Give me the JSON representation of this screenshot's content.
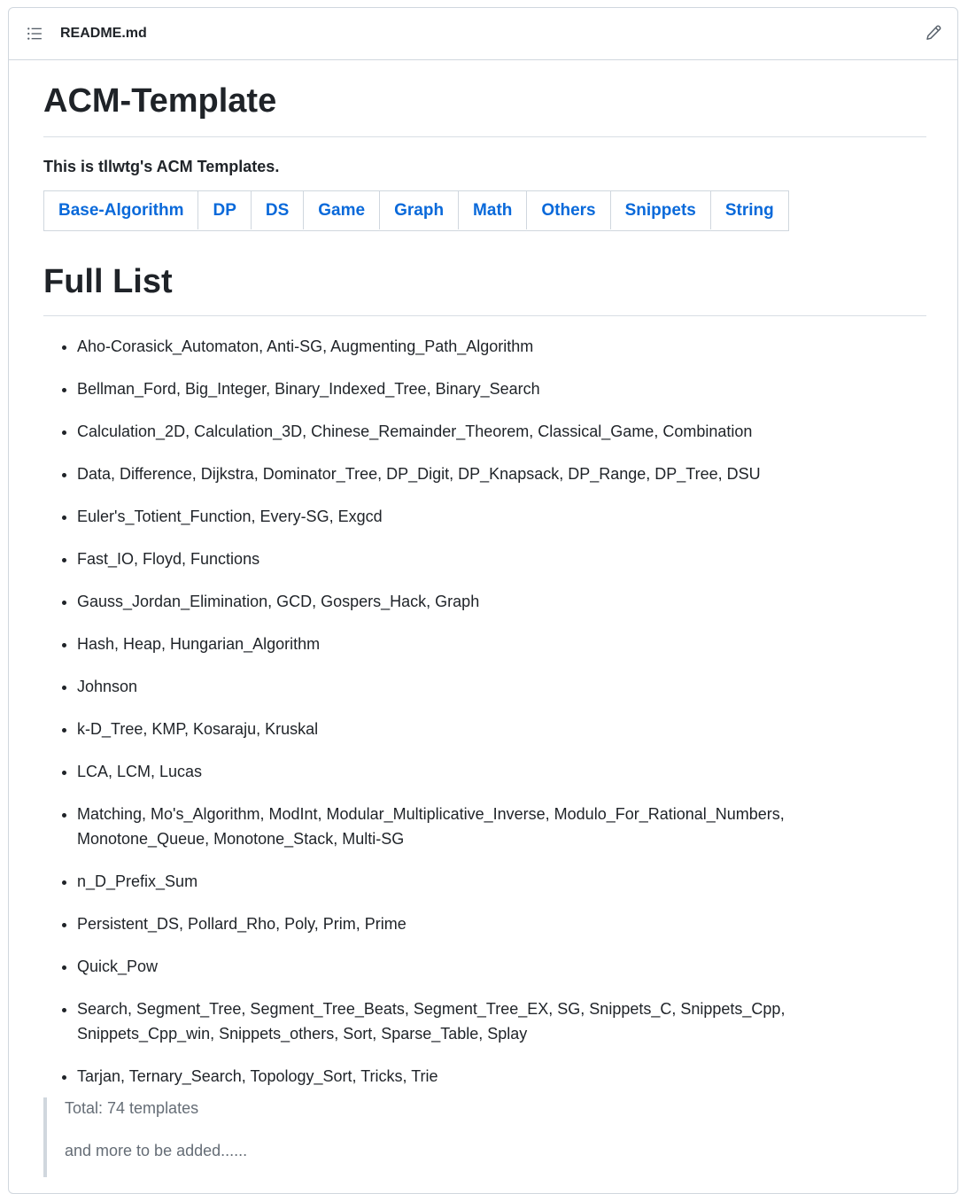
{
  "header": {
    "file_name": "README.md",
    "toc_icon": "list-unordered-icon",
    "edit_icon": "pencil-icon"
  },
  "readme": {
    "title": "ACM-Template",
    "intro": "This is tllwtg's ACM Templates.",
    "nav": [
      "Base-Algorithm",
      "DP",
      "DS",
      "Game",
      "Graph",
      "Math",
      "Others",
      "Snippets",
      "String"
    ],
    "full_list_heading": "Full List",
    "items": [
      "Aho-Corasick_Automaton, Anti-SG, Augmenting_Path_Algorithm",
      "Bellman_Ford, Big_Integer, Binary_Indexed_Tree, Binary_Search",
      "Calculation_2D, Calculation_3D, Chinese_Remainder_Theorem, Classical_Game, Combination",
      "Data, Difference, Dijkstra, Dominator_Tree, DP_Digit, DP_Knapsack, DP_Range, DP_Tree, DSU",
      "Euler's_Totient_Function, Every-SG, Exgcd",
      "Fast_IO, Floyd, Functions",
      "Gauss_Jordan_Elimination, GCD, Gospers_Hack, Graph",
      "Hash, Heap, Hungarian_Algorithm",
      "Johnson",
      "k-D_Tree, KMP, Kosaraju, Kruskal",
      "LCA, LCM, Lucas",
      "Matching, Mo's_Algorithm, ModInt, Modular_Multiplicative_Inverse, Modulo_For_Rational_Numbers, Monotone_Queue, Monotone_Stack, Multi-SG",
      "n_D_Prefix_Sum",
      "Persistent_DS, Pollard_Rho, Poly, Prim, Prime",
      "Quick_Pow",
      "Search, Segment_Tree, Segment_Tree_Beats, Segment_Tree_EX, SG, Snippets_C, Snippets_Cpp, Snippets_Cpp_win, Snippets_others, Sort, Sparse_Table, Splay",
      "Tarjan, Ternary_Search, Topology_Sort, Tricks, Trie"
    ],
    "quote": {
      "total": "Total: 74 templates",
      "more": "and more to be added......"
    }
  },
  "colors": {
    "link": "#0969da",
    "text": "#1f2328",
    "muted": "#656d76",
    "border": "#d0d7de"
  }
}
